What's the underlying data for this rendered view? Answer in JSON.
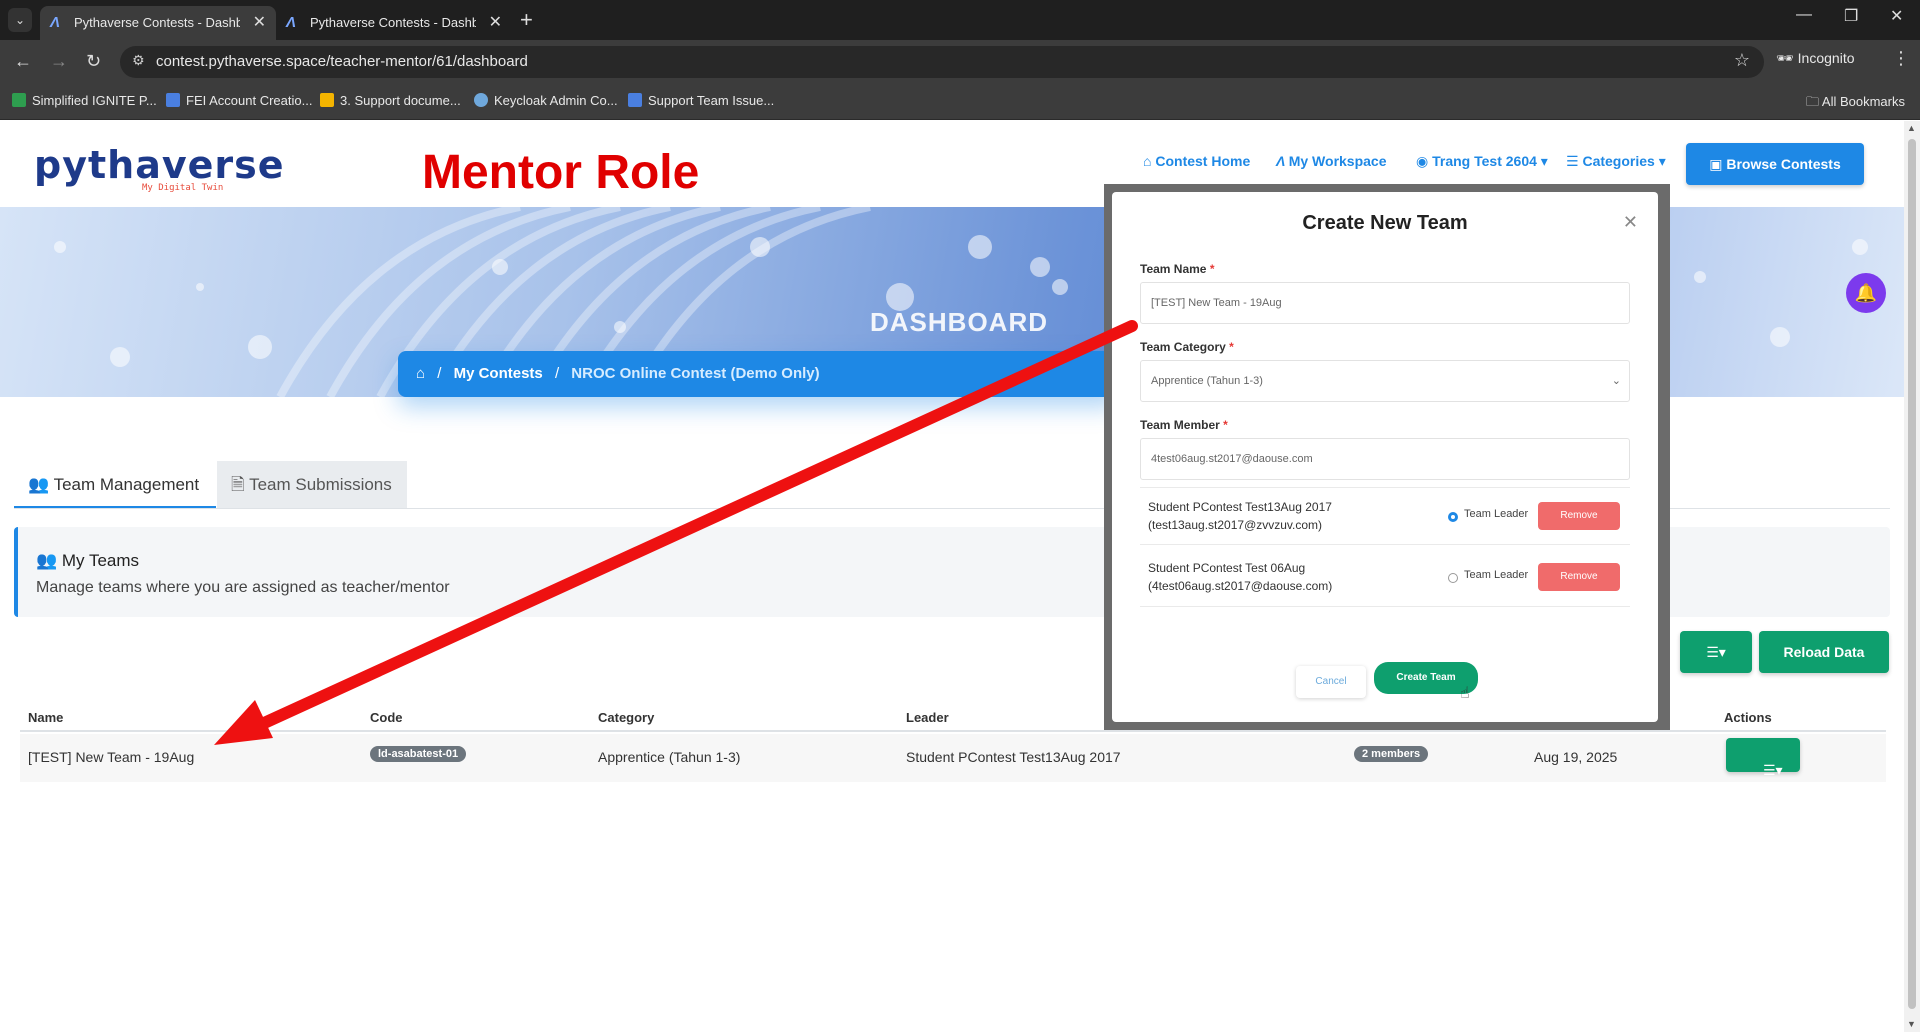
{
  "browser": {
    "tabs": [
      {
        "title": "Pythaverse Contests - Dashboard"
      },
      {
        "title": "Pythaverse Contests - Dashboard"
      }
    ],
    "url": "contest.pythaverse.space/teacher-mentor/61/dashboard",
    "incognito_label": "Incognito",
    "bookmarks": [
      {
        "label": "Simplified IGNITE P...",
        "color": "#2e9e4f"
      },
      {
        "label": "FEI Account Creatio...",
        "color": "#4a7fe0"
      },
      {
        "label": "3. Support docume...",
        "color": "#f4b400"
      },
      {
        "label": "Keycloak Admin Co...",
        "color": "#6fa8dc"
      },
      {
        "label": "Support Team Issue...",
        "color": "#4a7fe0"
      }
    ],
    "all_bookmarks": "All Bookmarks"
  },
  "header": {
    "logo": "pythaverse",
    "logo_sub": "My Digital Twin",
    "annotation": "Mentor Role",
    "nav": {
      "home": "Contest Home",
      "workspace": "My Workspace",
      "user": "Trang Test 2604",
      "categories": "Categories"
    },
    "browse": "Browse Contests"
  },
  "hero": {
    "title": "DASHBOARD",
    "breadcrumb": [
      "My Contests",
      "NROC Online Contest (Demo Only)"
    ]
  },
  "tabs": {
    "team_management": "Team Management",
    "team_submissions": "Team Submissions"
  },
  "my_teams": {
    "title": "My Teams",
    "description": "Manage teams where you are assigned as teacher/mentor"
  },
  "buttons": {
    "reload": "Reload Data"
  },
  "table": {
    "headers": {
      "name": "Name",
      "code": "Code",
      "category": "Category",
      "leader": "Leader",
      "actions": "Actions"
    },
    "rows": [
      {
        "name": "[TEST] New Team - 19Aug",
        "code": "ld-asabatest-01",
        "category": "Apprentice (Tahun 1-3)",
        "leader": "Student PContest Test13Aug 2017",
        "members": "2 members",
        "date": "Aug 19, 2025"
      }
    ]
  },
  "modal": {
    "title": "Create New Team",
    "team_name_label": "Team Name",
    "team_name_value": "[TEST] New Team - 19Aug",
    "team_category_label": "Team Category",
    "team_category_value": "Apprentice (Tahun 1-3)",
    "team_member_label": "Team Member",
    "team_member_value": "4test06aug.st2017@daouse.com",
    "required_mark": "*",
    "members": [
      {
        "name": "Student PContest Test13Aug 2017",
        "email": "(test13aug.st2017@zvvzuv.com)",
        "leader_label": "Team Leader",
        "is_leader": true,
        "remove": "Remove"
      },
      {
        "name": "Student PContest Test 06Aug",
        "email": "(4test06aug.st2017@daouse.com)",
        "leader_label": "Team Leader",
        "is_leader": false,
        "remove": "Remove"
      }
    ],
    "cancel": "Cancel",
    "create": "Create Team"
  },
  "colors": {
    "primary": "#1e88e5",
    "success": "#0e9f6e",
    "danger": "#f06b6b",
    "annotation": "#e00000",
    "bell": "#7c3aed"
  },
  "icons": {
    "home": "home-icon",
    "workspace": "workspace-icon",
    "user": "user-circle-icon",
    "categories": "list-icon",
    "browse": "calendar-icon",
    "bell": "bell-icon",
    "team": "users-icon",
    "file": "file-icon",
    "menu": "menu-icon",
    "close": "close-icon"
  }
}
